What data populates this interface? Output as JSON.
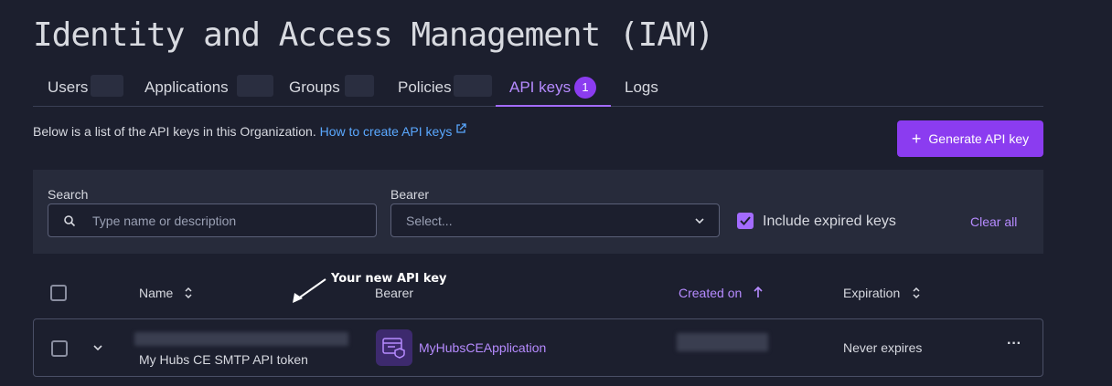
{
  "page": {
    "title": "Identity and Access Management (IAM)"
  },
  "tabs": [
    {
      "label": "Users"
    },
    {
      "label": "Applications"
    },
    {
      "label": "Groups"
    },
    {
      "label": "Policies"
    },
    {
      "label": "API keys",
      "badge": "1"
    },
    {
      "label": "Logs"
    }
  ],
  "intro": {
    "text": "Below is a list of the API keys in this Organization.",
    "link": "How to create API keys"
  },
  "actions": {
    "generate": "Generate API key"
  },
  "filters": {
    "search_label": "Search",
    "search_placeholder": "Type name or description",
    "bearer_label": "Bearer",
    "bearer_placeholder": "Select...",
    "include_expired": "Include expired keys",
    "clear_all": "Clear all"
  },
  "table": {
    "headers": {
      "name": "Name",
      "bearer": "Bearer",
      "created": "Created on",
      "expiration": "Expiration"
    },
    "annotation": "Your new API key",
    "rows": [
      {
        "description": "My Hubs CE SMTP API token",
        "bearer": "MyHubsCEApplication",
        "expiration": "Never expires"
      }
    ]
  },
  "colors": {
    "accent": "#a36bff",
    "link": "#5aa8ff",
    "background": "#1c1f2e"
  }
}
